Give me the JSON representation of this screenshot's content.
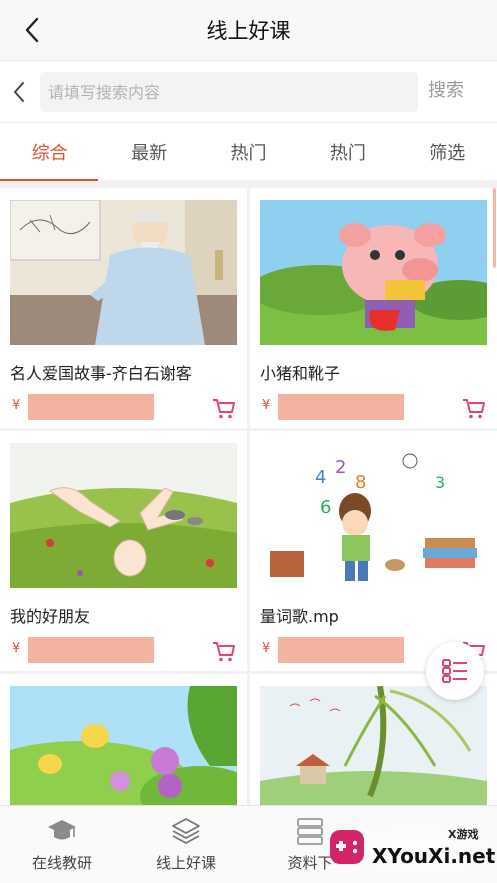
{
  "header": {
    "title": "线上好课"
  },
  "search": {
    "placeholder": "请填写搜索内容",
    "button_label": "搜索"
  },
  "tabs": [
    {
      "label": "综合",
      "active": true
    },
    {
      "label": "最新",
      "active": false
    },
    {
      "label": "热门",
      "active": false
    },
    {
      "label": "热门",
      "active": false
    },
    {
      "label": "筛选",
      "active": false
    }
  ],
  "courses": [
    {
      "title": "名人爱国故事-齐白石谢客",
      "currency": "¥",
      "thumb": "ink-painting-scholar"
    },
    {
      "title": "小猪和靴子",
      "currency": "¥",
      "thumb": "cartoon-pig-with-boot"
    },
    {
      "title": "我的好朋友",
      "currency": "¥",
      "thumb": "hands-on-grass"
    },
    {
      "title": "量词歌.mp",
      "currency": "¥",
      "thumb": "boy-with-numbers"
    },
    {
      "title": "",
      "currency": "",
      "thumb": "bees-and-flowers"
    },
    {
      "title": "",
      "currency": "",
      "thumb": "willow-landscape"
    }
  ],
  "bottom_nav": [
    {
      "label": "在线教研",
      "icon": "graduation-cap-icon"
    },
    {
      "label": "线上好课",
      "icon": "layers-icon"
    },
    {
      "label": "资料下",
      "icon": "database-icon"
    },
    {
      "label": "",
      "icon": "unknown-icon"
    }
  ],
  "watermark": {
    "text": "XYouXi.net",
    "small_text": "X游戏"
  },
  "colors": {
    "accent": "#e2532e",
    "price_placeholder": "#f2b3a0",
    "cart": "#e0456f"
  }
}
